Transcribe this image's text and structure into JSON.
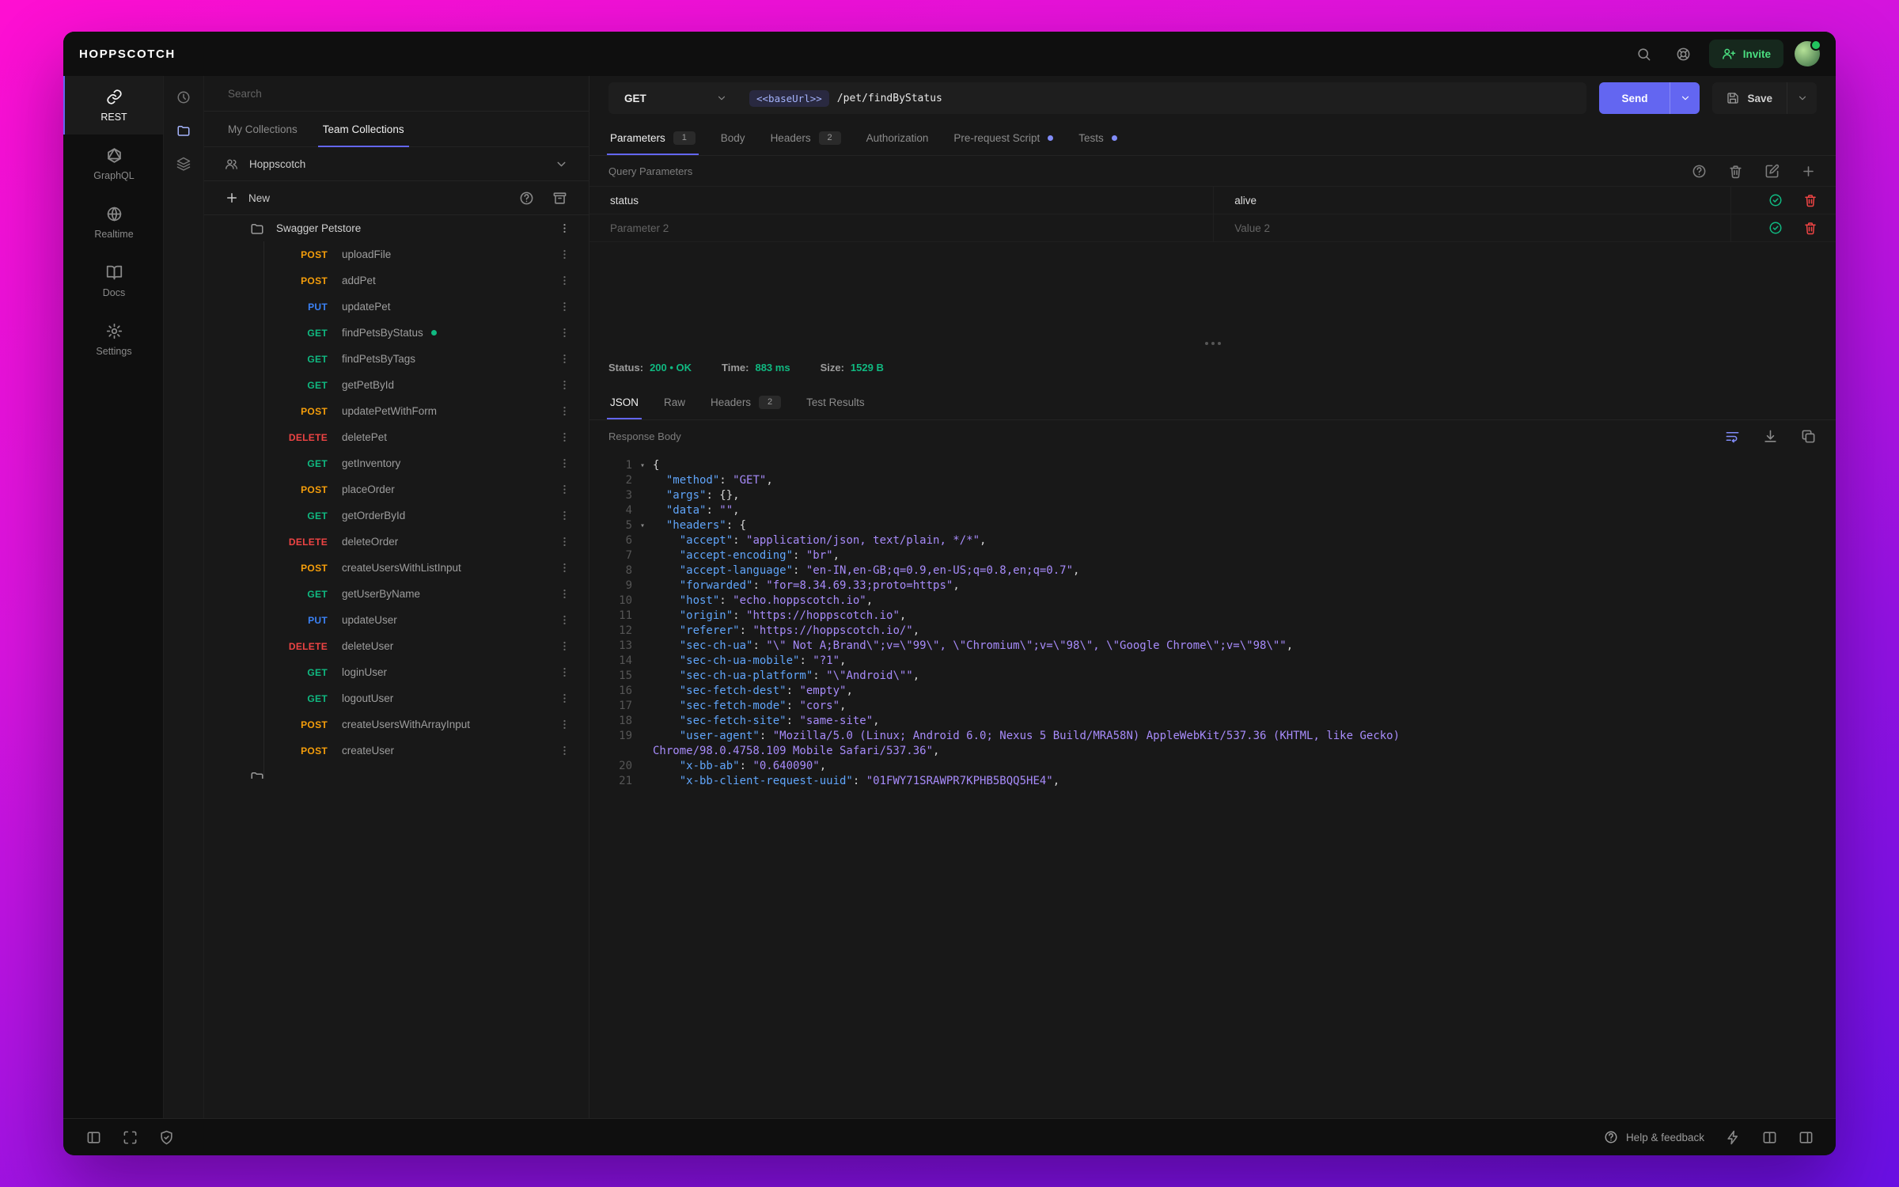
{
  "colors": {
    "accent": "#6366f1",
    "method_get": "#10b981",
    "method_post": "#f59e0b",
    "method_put": "#3b82f6",
    "method_delete": "#ef4444",
    "status_success": "#10b981",
    "chip_text": "#a5b4fc",
    "code_key": "#60a5fa",
    "code_string": "#a78bfa"
  },
  "topbar": {
    "logo": "HOPPSCOTCH",
    "invite_label": "Invite"
  },
  "nav": {
    "items": [
      {
        "label": "REST",
        "icon": "link",
        "active": true
      },
      {
        "label": "GraphQL",
        "icon": "graphql",
        "active": false
      },
      {
        "label": "Realtime",
        "icon": "globe",
        "active": false
      },
      {
        "label": "Docs",
        "icon": "book",
        "active": false
      },
      {
        "label": "Settings",
        "icon": "gear",
        "active": false
      }
    ]
  },
  "panel_switcher": [
    {
      "name": "history",
      "icon": "clock",
      "active": false
    },
    {
      "name": "collections",
      "icon": "folder",
      "active": true
    },
    {
      "name": "environments",
      "icon": "layers",
      "active": false
    }
  ],
  "collections": {
    "search_placeholder": "Search",
    "tabs": [
      {
        "label": "My Collections",
        "active": false
      },
      {
        "label": "Team Collections",
        "active": true
      }
    ],
    "team_name": "Hoppscotch",
    "new_label": "New",
    "folder_name": "Swagger Petstore",
    "requests": [
      {
        "method": "POST",
        "name": "uploadFile"
      },
      {
        "method": "POST",
        "name": "addPet"
      },
      {
        "method": "PUT",
        "name": "updatePet"
      },
      {
        "method": "GET",
        "name": "findPetsByStatus",
        "indicator": true
      },
      {
        "method": "GET",
        "name": "findPetsByTags"
      },
      {
        "method": "GET",
        "name": "getPetById"
      },
      {
        "method": "POST",
        "name": "updatePetWithForm"
      },
      {
        "method": "DELETE",
        "name": "deletePet"
      },
      {
        "method": "GET",
        "name": "getInventory"
      },
      {
        "method": "POST",
        "name": "placeOrder"
      },
      {
        "method": "GET",
        "name": "getOrderById"
      },
      {
        "method": "DELETE",
        "name": "deleteOrder"
      },
      {
        "method": "POST",
        "name": "createUsersWithListInput"
      },
      {
        "method": "GET",
        "name": "getUserByName"
      },
      {
        "method": "PUT",
        "name": "updateUser"
      },
      {
        "method": "DELETE",
        "name": "deleteUser"
      },
      {
        "method": "GET",
        "name": "loginUser"
      },
      {
        "method": "GET",
        "name": "logoutUser"
      },
      {
        "method": "POST",
        "name": "createUsersWithArrayInput"
      },
      {
        "method": "POST",
        "name": "createUser"
      }
    ],
    "partial_row": {
      "type": "folder",
      "label": ""
    }
  },
  "request": {
    "method": "GET",
    "base_url_chip": "<<baseUrl>>",
    "path": "/pet/findByStatus",
    "send_label": "Send",
    "save_label": "Save",
    "tabs": [
      {
        "label": "Parameters",
        "badge": "1",
        "active": true
      },
      {
        "label": "Body"
      },
      {
        "label": "Headers",
        "badge": "2"
      },
      {
        "label": "Authorization"
      },
      {
        "label": "Pre-request Script",
        "dot": true
      },
      {
        "label": "Tests",
        "dot": true
      }
    ],
    "section_title": "Query Parameters",
    "params": [
      {
        "key": "status",
        "value": "alive",
        "key_placeholder": "",
        "value_placeholder": ""
      },
      {
        "key": "",
        "value": "",
        "key_placeholder": "Parameter 2",
        "value_placeholder": "Value 2"
      }
    ]
  },
  "response": {
    "meta": [
      {
        "label": "Status:",
        "value": "200 • OK"
      },
      {
        "label": "Time:",
        "value": "883 ms"
      },
      {
        "label": "Size:",
        "value": "1529 B"
      }
    ],
    "tabs": [
      {
        "label": "JSON",
        "active": true
      },
      {
        "label": "Raw"
      },
      {
        "label": "Headers",
        "badge": "2"
      },
      {
        "label": "Test Results"
      }
    ],
    "body_label": "Response Body",
    "code_lines": [
      {
        "n": 1,
        "fold": true,
        "seg": [
          [
            "p",
            "{"
          ]
        ]
      },
      {
        "n": 2,
        "seg": [
          [
            "k",
            "  \"method\""
          ],
          [
            "p",
            ": "
          ],
          [
            "v",
            "\"GET\""
          ],
          [
            "p",
            ","
          ]
        ]
      },
      {
        "n": 3,
        "seg": [
          [
            "k",
            "  \"args\""
          ],
          [
            "p",
            ": "
          ],
          [
            "p",
            "{},"
          ]
        ]
      },
      {
        "n": 4,
        "seg": [
          [
            "k",
            "  \"data\""
          ],
          [
            "p",
            ": "
          ],
          [
            "v",
            "\"\""
          ],
          [
            "p",
            ","
          ]
        ]
      },
      {
        "n": 5,
        "fold": true,
        "seg": [
          [
            "k",
            "  \"headers\""
          ],
          [
            "p",
            ": "
          ],
          [
            "p",
            "{"
          ]
        ]
      },
      {
        "n": 6,
        "seg": [
          [
            "k",
            "    \"accept\""
          ],
          [
            "p",
            ": "
          ],
          [
            "v",
            "\"application/json, text/plain, */*\""
          ],
          [
            "p",
            ","
          ]
        ]
      },
      {
        "n": 7,
        "seg": [
          [
            "k",
            "    \"accept-encoding\""
          ],
          [
            "p",
            ": "
          ],
          [
            "v",
            "\"br\""
          ],
          [
            "p",
            ","
          ]
        ]
      },
      {
        "n": 8,
        "seg": [
          [
            "k",
            "    \"accept-language\""
          ],
          [
            "p",
            ": "
          ],
          [
            "v",
            "\"en-IN,en-GB;q=0.9,en-US;q=0.8,en;q=0.7\""
          ],
          [
            "p",
            ","
          ]
        ]
      },
      {
        "n": 9,
        "seg": [
          [
            "k",
            "    \"forwarded\""
          ],
          [
            "p",
            ": "
          ],
          [
            "v",
            "\"for=8.34.69.33;proto=https\""
          ],
          [
            "p",
            ","
          ]
        ]
      },
      {
        "n": 10,
        "seg": [
          [
            "k",
            "    \"host\""
          ],
          [
            "p",
            ": "
          ],
          [
            "v",
            "\"echo.hoppscotch.io\""
          ],
          [
            "p",
            ","
          ]
        ]
      },
      {
        "n": 11,
        "seg": [
          [
            "k",
            "    \"origin\""
          ],
          [
            "p",
            ": "
          ],
          [
            "v",
            "\"https://hoppscotch.io\""
          ],
          [
            "p",
            ","
          ]
        ]
      },
      {
        "n": 12,
        "seg": [
          [
            "k",
            "    \"referer\""
          ],
          [
            "p",
            ": "
          ],
          [
            "v",
            "\"https://hoppscotch.io/\""
          ],
          [
            "p",
            ","
          ]
        ]
      },
      {
        "n": 13,
        "seg": [
          [
            "k",
            "    \"sec-ch-ua\""
          ],
          [
            "p",
            ": "
          ],
          [
            "v",
            "\"\\\" Not A;Brand\\\";v=\\\"99\\\", \\\"Chromium\\\";v=\\\"98\\\", \\\"Google Chrome\\\";v=\\\"98\\\"\""
          ],
          [
            "p",
            ","
          ]
        ]
      },
      {
        "n": 14,
        "seg": [
          [
            "k",
            "    \"sec-ch-ua-mobile\""
          ],
          [
            "p",
            ": "
          ],
          [
            "v",
            "\"?1\""
          ],
          [
            "p",
            ","
          ]
        ]
      },
      {
        "n": 15,
        "seg": [
          [
            "k",
            "    \"sec-ch-ua-platform\""
          ],
          [
            "p",
            ": "
          ],
          [
            "v",
            "\"\\\"Android\\\"\""
          ],
          [
            "p",
            ","
          ]
        ]
      },
      {
        "n": 16,
        "seg": [
          [
            "k",
            "    \"sec-fetch-dest\""
          ],
          [
            "p",
            ": "
          ],
          [
            "v",
            "\"empty\""
          ],
          [
            "p",
            ","
          ]
        ]
      },
      {
        "n": 17,
        "seg": [
          [
            "k",
            "    \"sec-fetch-mode\""
          ],
          [
            "p",
            ": "
          ],
          [
            "v",
            "\"cors\""
          ],
          [
            "p",
            ","
          ]
        ]
      },
      {
        "n": 18,
        "seg": [
          [
            "k",
            "    \"sec-fetch-site\""
          ],
          [
            "p",
            ": "
          ],
          [
            "v",
            "\"same-site\""
          ],
          [
            "p",
            ","
          ]
        ]
      },
      {
        "n": 19,
        "seg": [
          [
            "k",
            "    \"user-agent\""
          ],
          [
            "p",
            ": "
          ],
          [
            "v",
            "\"Mozilla/5.0 (Linux; Android 6.0; Nexus 5 Build/MRA58N) AppleWebKit/537.36 (KHTML, like Gecko) Chrome/98.0.4758.109 Mobile Safari/537.36\""
          ],
          [
            "p",
            ","
          ]
        ]
      },
      {
        "n": 20,
        "seg": [
          [
            "k",
            "    \"x-bb-ab\""
          ],
          [
            "p",
            ": "
          ],
          [
            "v",
            "\"0.640090\""
          ],
          [
            "p",
            ","
          ]
        ]
      },
      {
        "n": 21,
        "seg": [
          [
            "k",
            "    \"x-bb-client-request-uuid\""
          ],
          [
            "p",
            ": "
          ],
          [
            "v",
            "\"01FWY71SRAWPR7KPHB5BQQ5HE4\""
          ],
          [
            "p",
            ","
          ]
        ]
      }
    ]
  },
  "statusbar": {
    "left_icons": [
      "panel-left",
      "maximize",
      "shield-check"
    ],
    "help_label": "Help & feedback",
    "right_icons": [
      "zap",
      "columns",
      "panel-right"
    ]
  }
}
